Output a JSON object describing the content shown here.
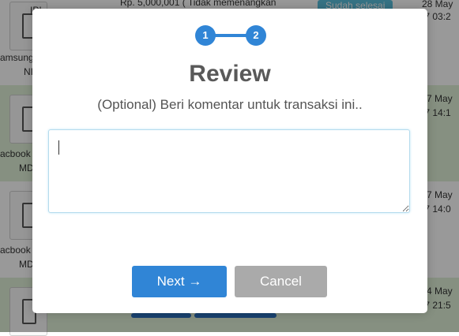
{
  "background": {
    "rows": [
      {
        "price_text": "Rp. 5,000,001 ( Tidak memenangkan",
        "product_text_1": "IPI",
        "product_text_2": "amsung",
        "product_text_3": "NI",
        "status_button": "Sudah selesai",
        "date_1": "28 May",
        "date_2": ".7 03:2"
      },
      {
        "product_text_1": "acbook",
        "product_text_2": "MD",
        "date_1": "7 May",
        "date_2": ".7 14:1"
      },
      {
        "product_text_1": "acbook",
        "product_text_2": "MD",
        "date_1": "7 May",
        "date_2": ".7 14:0"
      },
      {
        "date_1": "4 May",
        "date_2": ".7 21:5"
      }
    ]
  },
  "modal": {
    "steps": [
      "1",
      "2"
    ],
    "title": "Review",
    "subtitle": "(Optional) Beri komentar untuk transaksi ini..",
    "textarea_value": "",
    "next_label": "Next →",
    "cancel_label": "Cancel"
  },
  "colors": {
    "accent": "#3085d6",
    "cancel": "#aaaaaa",
    "row_green": "#dff0d8"
  }
}
